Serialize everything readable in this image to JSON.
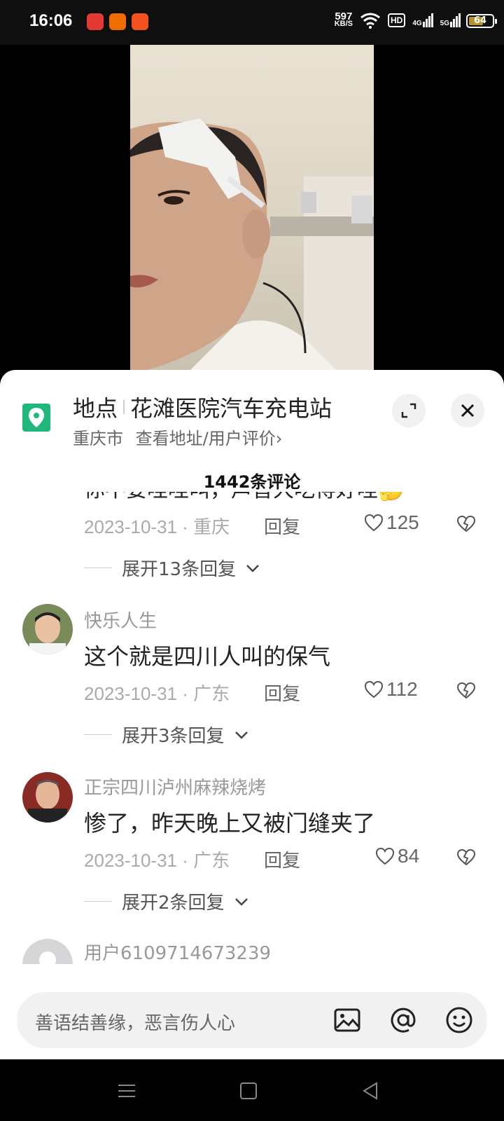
{
  "status": {
    "time": "16:06",
    "net_speed_value": "597",
    "net_speed_unit": "KB/S",
    "hd": "HD",
    "sig1": "4G",
    "sig2": "5G",
    "battery": "64",
    "battery_level": 0.64
  },
  "location": {
    "label": "地点",
    "name": "花滩医院汽车充电站",
    "city": "重庆市",
    "link": "查看地址/用户评价",
    "chevron": "›"
  },
  "comments_header": {
    "title": "1442条评论"
  },
  "comments": [
    {
      "text": "你不要哇哇叫，声音大吃得好哇🤔",
      "date": "2023-10-31 · 重庆",
      "reply": "回复",
      "likes": "125",
      "expand": "展开13条回复"
    },
    {
      "name": "快乐人生",
      "text": "这个就是四川人叫的保气",
      "date": "2023-10-31 · 广东",
      "reply": "回复",
      "likes": "112",
      "expand": "展开3条回复"
    },
    {
      "name": "正宗四川泸州麻辣烧烤",
      "text": "惨了，昨天晚上又被门缝夹了",
      "date": "2023-10-31 · 广东",
      "reply": "回复",
      "likes": "84",
      "expand": "展开2条回复"
    },
    {
      "name": "用户6109714673239"
    }
  ],
  "input": {
    "placeholder": "善语结善缘，恶言伤人心",
    "icons": [
      "image-icon",
      "at-icon",
      "emoji-icon"
    ]
  },
  "colors": {
    "location_green": "#1fb87a",
    "battery": "#b6932f"
  }
}
